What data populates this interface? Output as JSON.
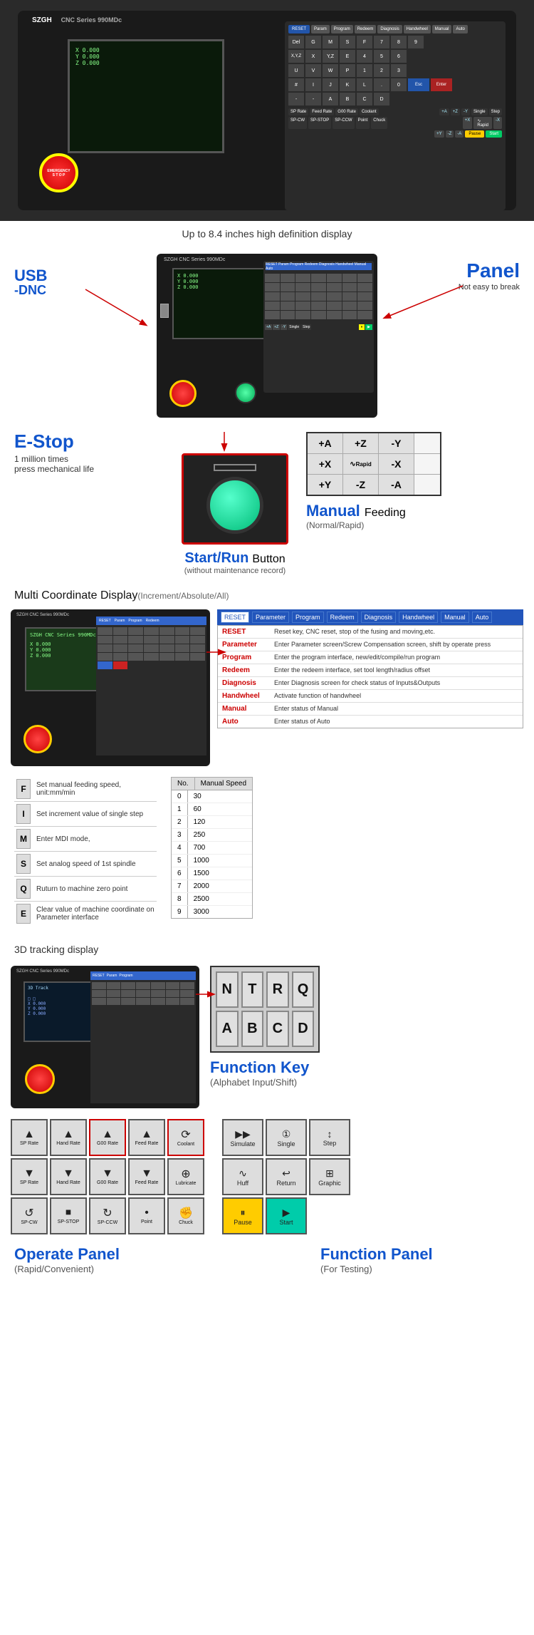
{
  "machine": {
    "brand": "SZGH",
    "model": "CNC Series 990MDc",
    "display_size": "Up to 8.4 inches high definition display"
  },
  "features": {
    "usb": {
      "label": "USB",
      "sub": "-DNC"
    },
    "panel": {
      "label": "Panel",
      "desc": "Not easy to break"
    },
    "estop": {
      "label": "E-Stop",
      "desc1": "1 million times",
      "desc2": "press mechanical life"
    },
    "startrun": {
      "label1": "Start/Run",
      "label2": "Button",
      "desc": "(without maintenance record)"
    },
    "manual_feeding": {
      "label1": "Manual",
      "label2": "Feeding",
      "desc": "(Normal/Rapid)"
    }
  },
  "manual_feeding_grid": {
    "rows": [
      [
        "+A",
        "+Z",
        "-Y"
      ],
      [
        "+X",
        "Rapid",
        "-X"
      ],
      [
        "+Y",
        "-Z",
        "-A"
      ]
    ]
  },
  "coord_display": {
    "title": "Multi Coordinate Display",
    "subtitle": "(Increment/Absolute/All)"
  },
  "key_panel": {
    "tabs": [
      "RESET",
      "Parameter",
      "Program",
      "Redeem",
      "Diagnosis",
      "Handwheel",
      "Manual",
      "Auto"
    ],
    "active_tab": "RESET",
    "rows": [
      {
        "key": "RESET",
        "desc": "Reset key, CNC reset, stop of the fusing and moving,etc."
      },
      {
        "key": "Parameter",
        "desc": "Enter Parameter screen/Screw Compensation screen, shift by operate press"
      },
      {
        "key": "Program",
        "desc": "Enter the program interface, new/edit/compile/run program"
      },
      {
        "key": "Redeem",
        "desc": "Enter the redeem interface, set tool length/radius offset"
      },
      {
        "key": "Diagnosis",
        "desc": "Enter Diagnosis screen for check status of Inputs&Outputs"
      },
      {
        "key": "Handwheel",
        "desc": "Activate function of handwheel"
      },
      {
        "key": "Manual",
        "desc": "Enter status of Manual"
      },
      {
        "key": "Auto",
        "desc": "Enter status of Auto"
      }
    ]
  },
  "letter_keys": [
    {
      "key": "F",
      "desc": "Set manual feeding speed, unit:mm/min"
    },
    {
      "key": "I",
      "desc": "Set increment value of single step"
    },
    {
      "key": "M",
      "desc": "Enter MDI mode,"
    },
    {
      "key": "S",
      "desc": "Set analog speed of 1st spindle"
    },
    {
      "key": "Q",
      "desc": "Ruturn to machine zero point"
    },
    {
      "key": "E",
      "desc": "Clear value of machine coordinate on Parameter interface"
    }
  ],
  "manual_speed_table": {
    "headers": [
      "No.",
      "Manual Speed"
    ],
    "rows": [
      [
        "0",
        "30"
      ],
      [
        "1",
        "60"
      ],
      [
        "2",
        "120"
      ],
      [
        "3",
        "250"
      ],
      [
        "4",
        "700"
      ],
      [
        "5",
        "1000"
      ],
      [
        "6",
        "1500"
      ],
      [
        "7",
        "2000"
      ],
      [
        "8",
        "2500"
      ],
      [
        "9",
        "3000"
      ]
    ]
  },
  "tracking": {
    "title": "3D tracking display"
  },
  "function_keys": {
    "title": "Function Key",
    "desc": "(Alphabet Input/Shift)",
    "keys": [
      "N",
      "T",
      "R",
      "Q",
      "A",
      "B",
      "C",
      "D"
    ]
  },
  "operate_panel": {
    "title": "Operate Panel",
    "desc": "(Rapid/Convenient)",
    "row1": [
      "SP Rate",
      "Hand Rate",
      "G00 Rate",
      "Feed Rate",
      "Coolant"
    ],
    "row2": [
      "SP Rate",
      "Hand Rate",
      "G00 Rate",
      "Feed Rate",
      "Lubricate"
    ],
    "row3": [
      "SP-CW",
      "SP-STOP",
      "SP-CCW",
      "Point",
      "Chuck"
    ]
  },
  "function_panel": {
    "title": "Function Panel",
    "desc": "(For Testing)",
    "row1": [
      "Simulate",
      "Single",
      "Step"
    ],
    "row2": [
      "Huff",
      "Return",
      "Graphic"
    ],
    "row3": [
      "Pause",
      "Start"
    ]
  }
}
